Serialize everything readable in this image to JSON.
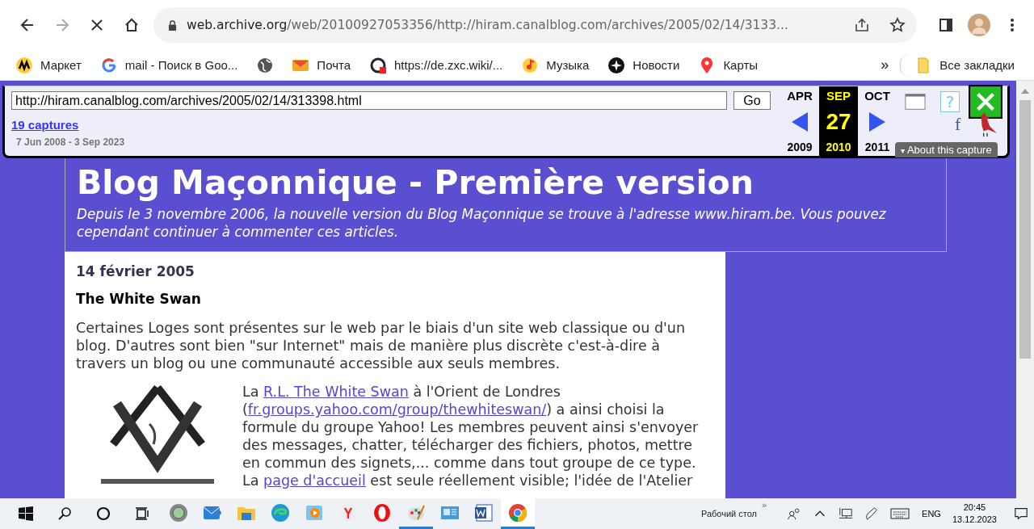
{
  "browser": {
    "url": {
      "domain": "web.archive.org",
      "path": "/web/20100927053356/http://hiram.canalblog.com/archives/2005/02/14/3133..."
    },
    "bookmarks": [
      {
        "kind": "market",
        "label": "Маркет"
      },
      {
        "kind": "google",
        "label": "mail - Поиск в Goo..."
      },
      {
        "kind": "globe"
      },
      {
        "kind": "mail",
        "label": "Почта"
      },
      {
        "kind": "qw",
        "label": "https://de.zxc.wiki/..."
      },
      {
        "kind": "music",
        "label": "Музыка"
      },
      {
        "kind": "news",
        "label": "Новости"
      },
      {
        "kind": "maps",
        "label": "Карты"
      }
    ],
    "more": "»",
    "all_bookmarks": "Все закладки"
  },
  "wayback": {
    "url_value": "http://hiram.canalblog.com/archives/2005/02/14/313398.html",
    "go": "Go",
    "captures": "19 captures",
    "range": "7 Jun 2008 - 3 Sep 2023",
    "months": [
      {
        "month": "APR",
        "year": "2009",
        "selected": false
      },
      {
        "month": "SEP",
        "day": "27",
        "year": "2010",
        "selected": true
      },
      {
        "month": "OCT",
        "year": "2011",
        "selected": false
      }
    ],
    "help": "?",
    "share": "f",
    "about_caret": "▾",
    "about": "About this capture"
  },
  "blog": {
    "title": "Blog Maçonnique - Première version",
    "subtitle": "Depuis le 3 novembre 2006, la nouvelle version du Blog Maçonnique se trouve à l'adresse www.hiram.be. Vous pouvez cependant continuer à commenter ces articles.",
    "date": "14 février 2005",
    "post_title": "The White Swan",
    "intro": "Certaines Loges sont présentes sur le web par le biais d'un site web classique ou d'un blog. D'autres sont bien \"sur Internet\" mais de manière plus discrète c'est-à-dire à travers un blog ou une communauté accessible aux seuls membres.",
    "body": [
      {
        "kind": "text",
        "text": "La "
      },
      {
        "kind": "link",
        "text": "R.L. The White Swan"
      },
      {
        "kind": "text",
        "text": " à l'Orient de Londres ("
      },
      {
        "kind": "link",
        "text": "fr.groups.yahoo.com/group/thewhiteswan/"
      },
      {
        "kind": "text",
        "text": ") a ainsi choisi la formule du groupe Yahoo! Les membres peuvent ainsi s'envoyer des messages, chatter, télécharger des fichiers, photos, mettre en commun des signets,... comme dans tout groupe de ce type. La "
      },
      {
        "kind": "link",
        "text": "page d'accueil"
      },
      {
        "kind": "text",
        "text": " est seule réellement visible; l'idée de l'Atelier"
      }
    ]
  },
  "taskbar": {
    "apps": [
      {
        "kind": "disc",
        "running": false,
        "selected": false
      },
      {
        "kind": "mail",
        "running": false,
        "selected": false
      },
      {
        "kind": "folder",
        "running": false,
        "selected": false
      },
      {
        "kind": "edge",
        "running": false,
        "selected": false
      },
      {
        "kind": "player",
        "running": false,
        "selected": false
      },
      {
        "kind": "yandex",
        "running": false,
        "selected": false
      },
      {
        "kind": "opera",
        "running": false,
        "selected": false
      },
      {
        "kind": "paint",
        "running": true,
        "selected": false
      },
      {
        "kind": "screen",
        "running": false,
        "selected": false
      },
      {
        "kind": "word",
        "running": false,
        "selected": false
      },
      {
        "kind": "chrome",
        "running": true,
        "selected": true
      }
    ],
    "desktop": "Рабочий стол",
    "chevron": "»",
    "lang": "ENG",
    "time": "20:45",
    "date": "13.12.2023"
  }
}
